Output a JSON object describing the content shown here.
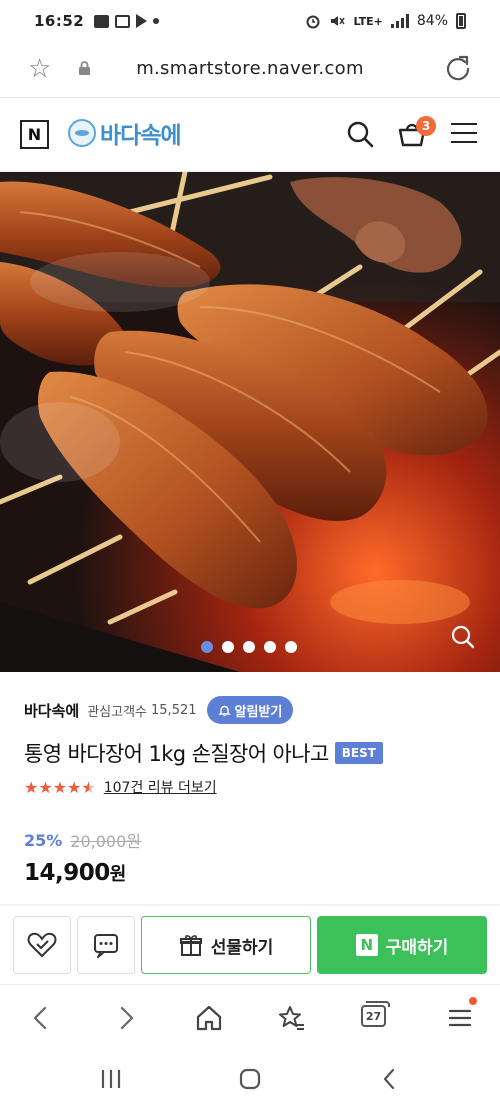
{
  "status_bar": {
    "time": "16:52",
    "network": "LTE+",
    "battery": "84%"
  },
  "browser": {
    "url": "m.smartstore.naver.com"
  },
  "header": {
    "n_badge": "N",
    "logo_text": "바다속에",
    "cart_count": "3"
  },
  "gallery": {
    "image_count": 5,
    "active_index": 0
  },
  "product": {
    "store_name": "바다속에",
    "fans_label": "관심고객수",
    "fans_count": "15,521",
    "alert_button": "알림받기",
    "title": "통영 바다장어 1kg 손질장어 아나고",
    "badge": "BEST",
    "rating_stars": 4.5,
    "review_link": "107건 리뷰 더보기",
    "discount": "25%",
    "original_price": "20,000원",
    "sale_price": "14,900",
    "currency": "원"
  },
  "actions": {
    "gift_label": "선물하기",
    "buy_label": "구매하기",
    "npay_letter": "N"
  },
  "browser_nav": {
    "tab_count": "27"
  },
  "colors": {
    "accent_blue": "#5d7fd6",
    "buy_green": "#3cc15a",
    "star_red": "#f25a3d",
    "cart_badge": "#f26b3a"
  }
}
